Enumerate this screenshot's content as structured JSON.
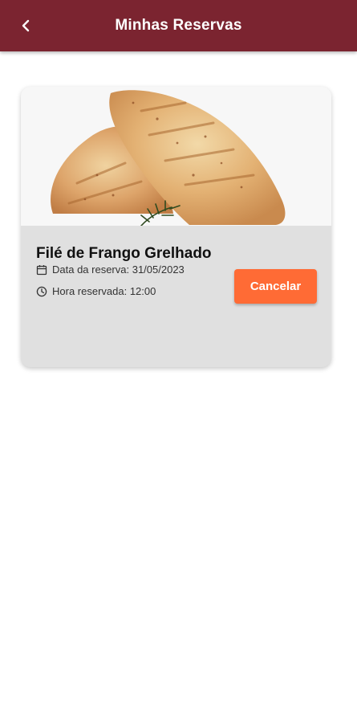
{
  "app_bar": {
    "title": "Minhas Reservas",
    "back_icon": "chevron-left-icon",
    "background_color": "#7b2430"
  },
  "reservations": [
    {
      "dish_name": "Filé de Frango Grelhado",
      "image_icon": "grilled-chicken-photo",
      "date_icon": "calendar-icon",
      "date_text": "Data da reserva: 31/05/2023",
      "time_icon": "clock-icon",
      "time_text": "Hora reservada: 12:00",
      "cancel_label": "Cancelar",
      "cancel_color": "#ff6b35"
    }
  ]
}
